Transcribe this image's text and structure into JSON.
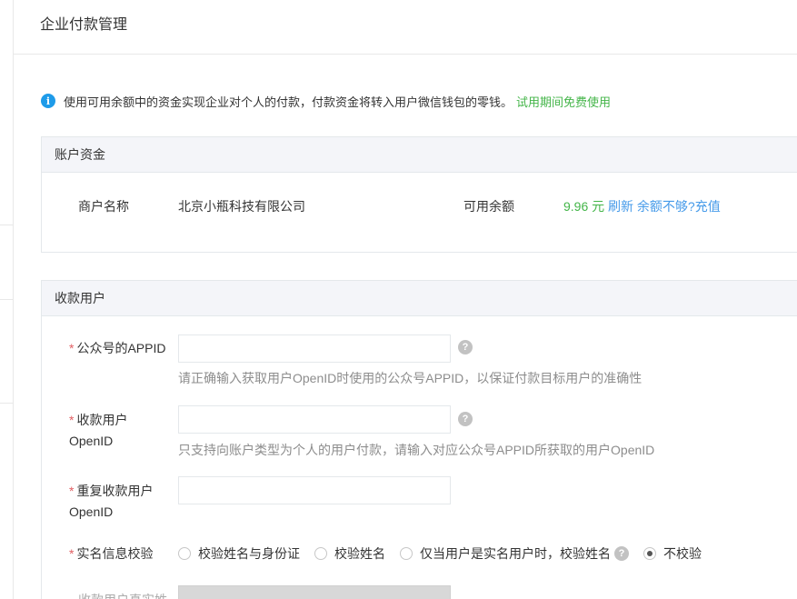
{
  "page": {
    "title": "企业付款管理"
  },
  "notice": {
    "text": "使用可用余额中的资金实现企业对个人的付款，付款资金将转入用户微信钱包的零钱。",
    "trial": "试用期间免费使用"
  },
  "account": {
    "header": "账户资金",
    "merchant_label": "商户名称",
    "merchant_value": "北京小瓶科技有限公司",
    "balance_label": "可用余额",
    "balance_value": "9.96 元",
    "refresh": "刷新",
    "insufficient": "余额不够?",
    "recharge": "充值"
  },
  "payee": {
    "header": "收款用户",
    "required_mark": "*",
    "appid_label": "公众号的APPID",
    "appid_value": "",
    "appid_hint": "请正确输入获取用户OpenID时使用的公众号APPID，以保证付款目标用户的准确性",
    "openid_label": "收款用户OpenID",
    "openid_value": "",
    "openid_hint": "只支持向账户类型为个人的用户付款，请输入对应公众号APPID所获取的用户OpenID",
    "repeat_openid_label": "重复收款用户OpenID",
    "repeat_openid_value": "",
    "verify_label": "实名信息校验",
    "verify_options": [
      "校验姓名与身份证",
      "校验姓名",
      "仅当用户是实名用户时，校验姓名",
      "不校验"
    ],
    "verify_selected": "不校验",
    "realname_label": "收款用户真实姓"
  },
  "icons": {
    "info": "info-icon",
    "help": "question-mark-icon"
  },
  "colors": {
    "accent_green": "#44b549",
    "link_blue": "#459ae9",
    "info_blue": "#1e9be9",
    "required_red": "#e15f63"
  }
}
